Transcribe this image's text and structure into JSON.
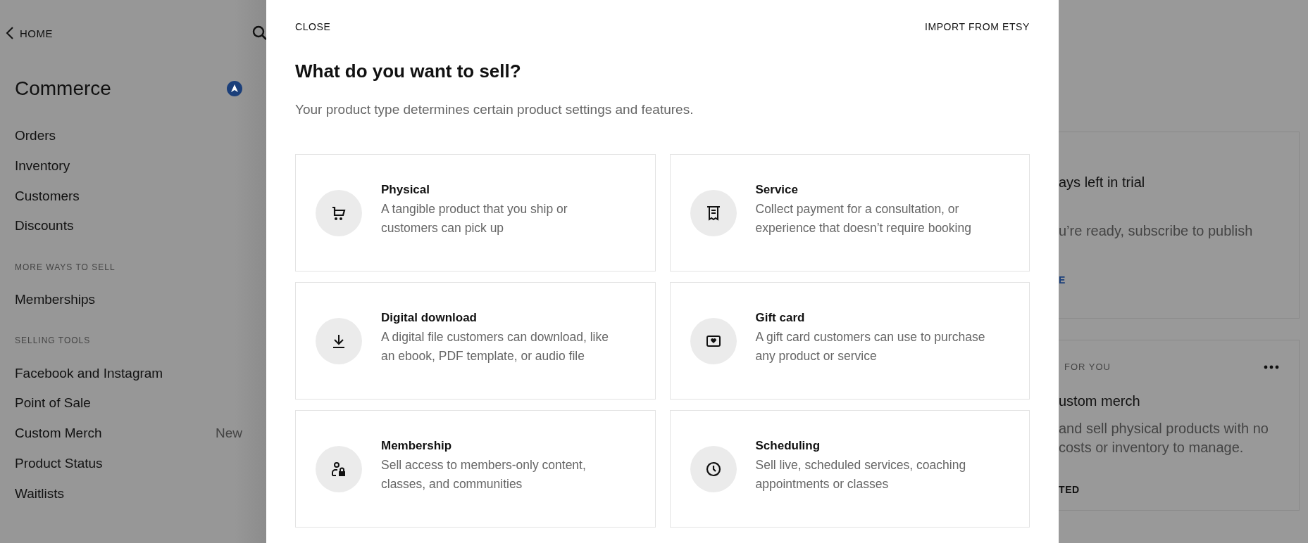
{
  "sidebar": {
    "back_link": "HOME",
    "title": "Commerce",
    "sections": [
      {
        "items": [
          {
            "label": "Orders"
          },
          {
            "label": "Inventory"
          },
          {
            "label": "Customers"
          },
          {
            "label": "Discounts"
          }
        ]
      },
      {
        "heading": "MORE WAYS TO SELL",
        "items": [
          {
            "label": "Memberships"
          }
        ]
      },
      {
        "heading": "SELLING TOOLS",
        "items": [
          {
            "label": "Facebook and Instagram"
          },
          {
            "label": "Point of Sale"
          },
          {
            "label": "Custom Merch",
            "badge": "New"
          },
          {
            "label": "Product Status"
          },
          {
            "label": "Waitlists"
          }
        ]
      }
    ]
  },
  "modal": {
    "close": "CLOSE",
    "import": "IMPORT FROM ETSY",
    "title": "What do you want to sell?",
    "subtitle": "Your product type determines certain product settings and features.",
    "options": [
      {
        "kind": "cart",
        "title": "Physical",
        "description": "A tangible product that you ship or customers can pick up"
      },
      {
        "kind": "receipt",
        "title": "Service",
        "description": "Collect payment for a consultation, or experience that doesn’t require booking"
      },
      {
        "kind": "download",
        "title": "Digital download",
        "description": "A digital file customers can download, like an ebook, PDF template, or audio file"
      },
      {
        "kind": "giftcard",
        "title": "Gift card",
        "description": "A gift card customers can use to purchase any product or service"
      },
      {
        "kind": "member",
        "title": "Membership",
        "description": "Sell access to members-only content, classes, and communities"
      },
      {
        "kind": "clock",
        "title": "Scheduling",
        "description": "Sell live, scheduled services, coaching appointments or classes"
      }
    ]
  },
  "background_cards": [
    {
      "title": "ays left in trial",
      "text": "u’re ready, subscribe to publish",
      "link": "E"
    },
    {
      "eyebrow": "FOR YOU",
      "title": "ustom merch",
      "text": "and sell physical products with no costs or inventory to manage.",
      "link": "TED"
    }
  ]
}
